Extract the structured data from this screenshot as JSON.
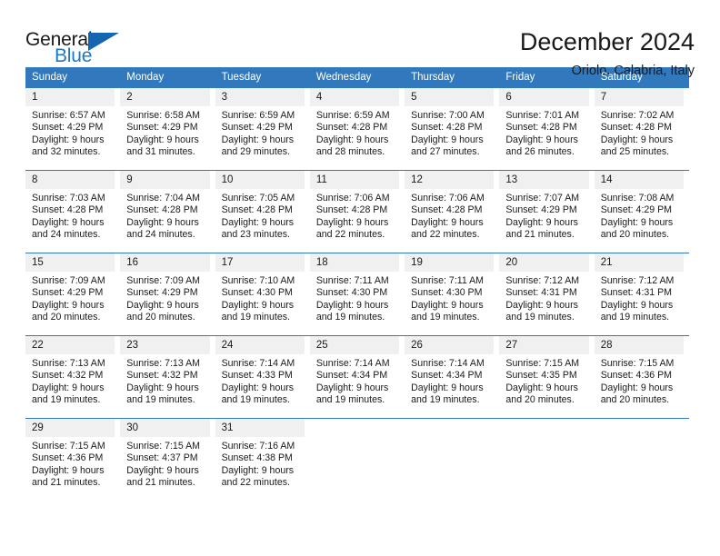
{
  "logo": {
    "text_primary": "General",
    "text_secondary": "Blue",
    "icon": "triangle-mark"
  },
  "header": {
    "title": "December 2024",
    "subtitle": "Oriolo, Calabria, Italy"
  },
  "colors": {
    "header_blue": "#3179bc",
    "logo_blue": "#1e78c8",
    "day_strip_gray": "#f0f0f0"
  },
  "calendar": {
    "weekday_headers": [
      "Sunday",
      "Monday",
      "Tuesday",
      "Wednesday",
      "Thursday",
      "Friday",
      "Saturday"
    ],
    "weeks": [
      [
        {
          "day": "1",
          "sunrise": "Sunrise: 6:57 AM",
          "sunset": "Sunset: 4:29 PM",
          "daylight_line1": "Daylight: 9 hours",
          "daylight_line2": "and 32 minutes."
        },
        {
          "day": "2",
          "sunrise": "Sunrise: 6:58 AM",
          "sunset": "Sunset: 4:29 PM",
          "daylight_line1": "Daylight: 9 hours",
          "daylight_line2": "and 31 minutes."
        },
        {
          "day": "3",
          "sunrise": "Sunrise: 6:59 AM",
          "sunset": "Sunset: 4:29 PM",
          "daylight_line1": "Daylight: 9 hours",
          "daylight_line2": "and 29 minutes."
        },
        {
          "day": "4",
          "sunrise": "Sunrise: 6:59 AM",
          "sunset": "Sunset: 4:28 PM",
          "daylight_line1": "Daylight: 9 hours",
          "daylight_line2": "and 28 minutes."
        },
        {
          "day": "5",
          "sunrise": "Sunrise: 7:00 AM",
          "sunset": "Sunset: 4:28 PM",
          "daylight_line1": "Daylight: 9 hours",
          "daylight_line2": "and 27 minutes."
        },
        {
          "day": "6",
          "sunrise": "Sunrise: 7:01 AM",
          "sunset": "Sunset: 4:28 PM",
          "daylight_line1": "Daylight: 9 hours",
          "daylight_line2": "and 26 minutes."
        },
        {
          "day": "7",
          "sunrise": "Sunrise: 7:02 AM",
          "sunset": "Sunset: 4:28 PM",
          "daylight_line1": "Daylight: 9 hours",
          "daylight_line2": "and 25 minutes."
        }
      ],
      [
        {
          "day": "8",
          "sunrise": "Sunrise: 7:03 AM",
          "sunset": "Sunset: 4:28 PM",
          "daylight_line1": "Daylight: 9 hours",
          "daylight_line2": "and 24 minutes."
        },
        {
          "day": "9",
          "sunrise": "Sunrise: 7:04 AM",
          "sunset": "Sunset: 4:28 PM",
          "daylight_line1": "Daylight: 9 hours",
          "daylight_line2": "and 24 minutes."
        },
        {
          "day": "10",
          "sunrise": "Sunrise: 7:05 AM",
          "sunset": "Sunset: 4:28 PM",
          "daylight_line1": "Daylight: 9 hours",
          "daylight_line2": "and 23 minutes."
        },
        {
          "day": "11",
          "sunrise": "Sunrise: 7:06 AM",
          "sunset": "Sunset: 4:28 PM",
          "daylight_line1": "Daylight: 9 hours",
          "daylight_line2": "and 22 minutes."
        },
        {
          "day": "12",
          "sunrise": "Sunrise: 7:06 AM",
          "sunset": "Sunset: 4:28 PM",
          "daylight_line1": "Daylight: 9 hours",
          "daylight_line2": "and 22 minutes."
        },
        {
          "day": "13",
          "sunrise": "Sunrise: 7:07 AM",
          "sunset": "Sunset: 4:29 PM",
          "daylight_line1": "Daylight: 9 hours",
          "daylight_line2": "and 21 minutes."
        },
        {
          "day": "14",
          "sunrise": "Sunrise: 7:08 AM",
          "sunset": "Sunset: 4:29 PM",
          "daylight_line1": "Daylight: 9 hours",
          "daylight_line2": "and 20 minutes."
        }
      ],
      [
        {
          "day": "15",
          "sunrise": "Sunrise: 7:09 AM",
          "sunset": "Sunset: 4:29 PM",
          "daylight_line1": "Daylight: 9 hours",
          "daylight_line2": "and 20 minutes."
        },
        {
          "day": "16",
          "sunrise": "Sunrise: 7:09 AM",
          "sunset": "Sunset: 4:29 PM",
          "daylight_line1": "Daylight: 9 hours",
          "daylight_line2": "and 20 minutes."
        },
        {
          "day": "17",
          "sunrise": "Sunrise: 7:10 AM",
          "sunset": "Sunset: 4:30 PM",
          "daylight_line1": "Daylight: 9 hours",
          "daylight_line2": "and 19 minutes."
        },
        {
          "day": "18",
          "sunrise": "Sunrise: 7:11 AM",
          "sunset": "Sunset: 4:30 PM",
          "daylight_line1": "Daylight: 9 hours",
          "daylight_line2": "and 19 minutes."
        },
        {
          "day": "19",
          "sunrise": "Sunrise: 7:11 AM",
          "sunset": "Sunset: 4:30 PM",
          "daylight_line1": "Daylight: 9 hours",
          "daylight_line2": "and 19 minutes."
        },
        {
          "day": "20",
          "sunrise": "Sunrise: 7:12 AM",
          "sunset": "Sunset: 4:31 PM",
          "daylight_line1": "Daylight: 9 hours",
          "daylight_line2": "and 19 minutes."
        },
        {
          "day": "21",
          "sunrise": "Sunrise: 7:12 AM",
          "sunset": "Sunset: 4:31 PM",
          "daylight_line1": "Daylight: 9 hours",
          "daylight_line2": "and 19 minutes."
        }
      ],
      [
        {
          "day": "22",
          "sunrise": "Sunrise: 7:13 AM",
          "sunset": "Sunset: 4:32 PM",
          "daylight_line1": "Daylight: 9 hours",
          "daylight_line2": "and 19 minutes."
        },
        {
          "day": "23",
          "sunrise": "Sunrise: 7:13 AM",
          "sunset": "Sunset: 4:32 PM",
          "daylight_line1": "Daylight: 9 hours",
          "daylight_line2": "and 19 minutes."
        },
        {
          "day": "24",
          "sunrise": "Sunrise: 7:14 AM",
          "sunset": "Sunset: 4:33 PM",
          "daylight_line1": "Daylight: 9 hours",
          "daylight_line2": "and 19 minutes."
        },
        {
          "day": "25",
          "sunrise": "Sunrise: 7:14 AM",
          "sunset": "Sunset: 4:34 PM",
          "daylight_line1": "Daylight: 9 hours",
          "daylight_line2": "and 19 minutes."
        },
        {
          "day": "26",
          "sunrise": "Sunrise: 7:14 AM",
          "sunset": "Sunset: 4:34 PM",
          "daylight_line1": "Daylight: 9 hours",
          "daylight_line2": "and 19 minutes."
        },
        {
          "day": "27",
          "sunrise": "Sunrise: 7:15 AM",
          "sunset": "Sunset: 4:35 PM",
          "daylight_line1": "Daylight: 9 hours",
          "daylight_line2": "and 20 minutes."
        },
        {
          "day": "28",
          "sunrise": "Sunrise: 7:15 AM",
          "sunset": "Sunset: 4:36 PM",
          "daylight_line1": "Daylight: 9 hours",
          "daylight_line2": "and 20 minutes."
        }
      ],
      [
        {
          "day": "29",
          "sunrise": "Sunrise: 7:15 AM",
          "sunset": "Sunset: 4:36 PM",
          "daylight_line1": "Daylight: 9 hours",
          "daylight_line2": "and 21 minutes."
        },
        {
          "day": "30",
          "sunrise": "Sunrise: 7:15 AM",
          "sunset": "Sunset: 4:37 PM",
          "daylight_line1": "Daylight: 9 hours",
          "daylight_line2": "and 21 minutes."
        },
        {
          "day": "31",
          "sunrise": "Sunrise: 7:16 AM",
          "sunset": "Sunset: 4:38 PM",
          "daylight_line1": "Daylight: 9 hours",
          "daylight_line2": "and 22 minutes."
        },
        {
          "day": "",
          "sunrise": "",
          "sunset": "",
          "daylight_line1": "",
          "daylight_line2": ""
        },
        {
          "day": "",
          "sunrise": "",
          "sunset": "",
          "daylight_line1": "",
          "daylight_line2": ""
        },
        {
          "day": "",
          "sunrise": "",
          "sunset": "",
          "daylight_line1": "",
          "daylight_line2": ""
        },
        {
          "day": "",
          "sunrise": "",
          "sunset": "",
          "daylight_line1": "",
          "daylight_line2": ""
        }
      ]
    ]
  }
}
